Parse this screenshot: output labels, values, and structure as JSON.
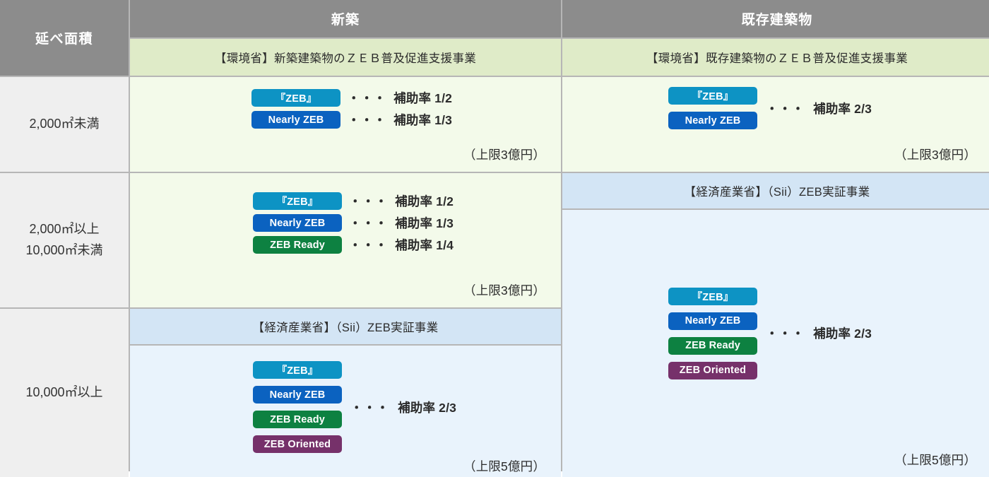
{
  "table": {
    "corner_header": "延べ面積",
    "column_headers": [
      {
        "label": "新築"
      },
      {
        "label": "既存建築物"
      }
    ],
    "program_headers": {
      "env_new": "【環境省】新築建築物のＺＥＢ普及促進支援事業",
      "env_existing": "【環境省】既存建築物のＺＥＢ普及促進支援事業",
      "meti_new": "【経済産業省】（Sii）ZEB実証事業",
      "meti_existing": "【経済産業省】（Sii）ZEB実証事業"
    },
    "row_labels": {
      "row1": {
        "line1": "2,000㎡未満"
      },
      "row2": {
        "line1": "2,000㎡以上",
        "line2": "10,000㎡未満"
      },
      "row3": {
        "line1": "10,000㎡以上"
      }
    },
    "badges": {
      "zeb": "『ZEB』",
      "nearly": "Nearly ZEB",
      "ready": "ZEB Ready",
      "oriented": "ZEB Oriented"
    },
    "dots": "・・・",
    "rates": {
      "half": "補助率 1/2",
      "third": "補助率 1/3",
      "quarter": "補助率 1/4",
      "two_thirds": "補助率 2/3"
    },
    "caps": {
      "three": "（上限3億円）",
      "five": "（上限5億円）"
    },
    "colors": {
      "header_gray": "#8c8c8c",
      "program_green": "#dfebc8",
      "program_blue": "#d3e5f5",
      "cell_green": "#f3faea",
      "cell_blue": "#e9f3fc",
      "rowlabel_gray": "#efefef",
      "badge_zeb": "#0d93c4",
      "badge_nearly": "#0b62c0",
      "badge_ready": "#0d8141",
      "badge_oriented": "#76316a",
      "border": "#b6b6b6"
    }
  }
}
